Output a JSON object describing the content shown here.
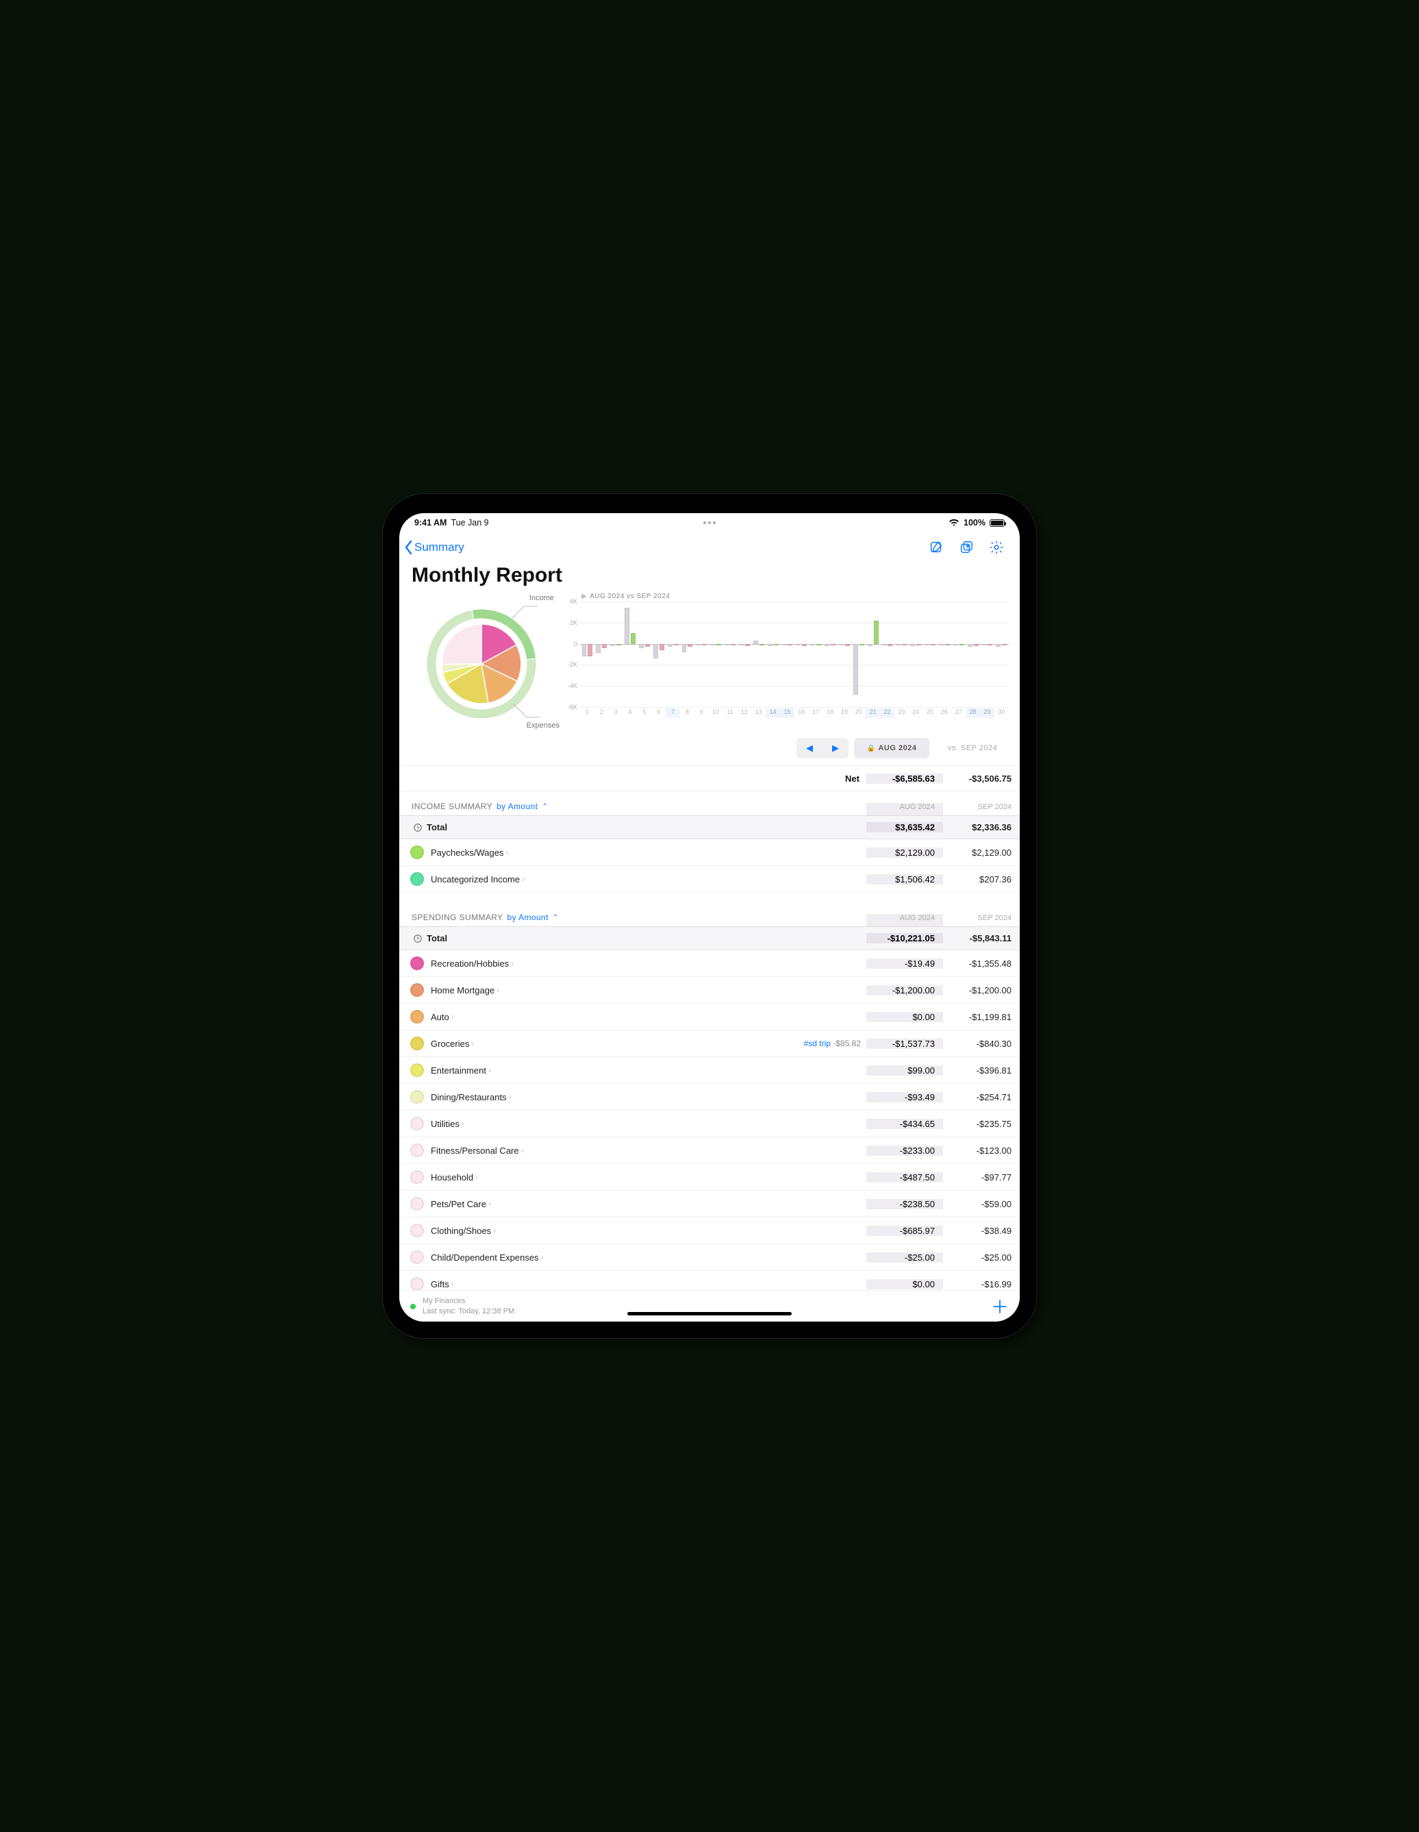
{
  "status": {
    "time": "9:41 AM",
    "date": "Tue Jan 9",
    "battery": "100%"
  },
  "nav": {
    "back": "Summary"
  },
  "title": "Monthly Report",
  "donut": {
    "income_label": "Income",
    "expenses_label": "Expenses"
  },
  "bar_legend": "AUG 2024 vs SEP 2024",
  "period": {
    "aug": "AUG 2024",
    "sep_vs": "vs. SEP 2024"
  },
  "net": {
    "label": "Net",
    "aug": "-$6,585.63",
    "sep": "-$3,506.75"
  },
  "income": {
    "header": "INCOME SUMMARY",
    "sort": "by Amount",
    "col_aug": "AUG 2024",
    "col_sep": "SEP 2024",
    "total_label": "Total",
    "total_aug": "$3,635.42",
    "total_sep": "$2,336.36",
    "rows": [
      {
        "name": "Paychecks/Wages",
        "aug": "$2,129.00",
        "sep": "$2,129.00",
        "color": "#a3e160"
      },
      {
        "name": "Uncategorized Income",
        "aug": "$1,506.42",
        "sep": "$207.36",
        "color": "#5be0a4"
      }
    ]
  },
  "spending": {
    "header": "SPENDING SUMMARY",
    "sort": "by Amount",
    "col_aug": "AUG 2024",
    "col_sep": "SEP 2024",
    "total_label": "Total",
    "total_aug": "-$10,221.05",
    "total_sep": "-$5,843.11",
    "rows": [
      {
        "name": "Recreation/Hobbies",
        "aug": "-$19.49",
        "sep": "-$1,355.48",
        "color": "#e75ca6"
      },
      {
        "name": "Home Mortgage",
        "aug": "-$1,200.00",
        "sep": "-$1,200.00",
        "color": "#ea9a6e"
      },
      {
        "name": "Auto",
        "aug": "$0.00",
        "sep": "-$1,199.81",
        "color": "#efb069"
      },
      {
        "name": "Groceries",
        "aug": "-$1,537.73",
        "sep": "-$840.30",
        "color": "#e7d55a",
        "note_tag": "#sd trip",
        "note_amt": "-$85.82"
      },
      {
        "name": "Entertainment",
        "aug": "$99.00",
        "sep": "-$396.81",
        "color": "#e9e96b"
      },
      {
        "name": "Dining/Restaurants",
        "aug": "-$93.49",
        "sep": "-$254.71",
        "color": "#eef2c0"
      },
      {
        "name": "Utilities",
        "aug": "-$434.65",
        "sep": "-$235.75",
        "color": "#fbe8ef"
      },
      {
        "name": "Fitness/Personal Care",
        "aug": "-$233.00",
        "sep": "-$123.00",
        "color": "#fbe8ef"
      },
      {
        "name": "Household",
        "aug": "-$487.50",
        "sep": "-$97.77",
        "color": "#fbe8ef"
      },
      {
        "name": "Pets/Pet Care",
        "aug": "-$238.50",
        "sep": "-$59.00",
        "color": "#fbe8ef"
      },
      {
        "name": "Clothing/Shoes",
        "aug": "-$685.97",
        "sep": "-$38.49",
        "color": "#fbe8ef"
      },
      {
        "name": "Child/Dependent Expenses",
        "aug": "-$25.00",
        "sep": "-$25.00",
        "color": "#fbe8ef"
      },
      {
        "name": "Gifts",
        "aug": "$0.00",
        "sep": "-$16.99",
        "color": "#fbe8ef"
      }
    ]
  },
  "footer": {
    "account": "My Finances",
    "sync": "Last sync: Today, 12:38 PM"
  },
  "chart_data": {
    "donut": {
      "type": "pie",
      "title": "",
      "outer_ring": [
        {
          "name": "Income",
          "value": 3635.42,
          "color": "#9fd98f"
        },
        {
          "name": "Expenses",
          "value": 10221.05,
          "color": "#cfe8c2"
        }
      ],
      "inner_pie_expense_breakdown": [
        {
          "name": "Recreation/Hobbies",
          "value": 1355,
          "color": "#e75ca6"
        },
        {
          "name": "Home Mortgage",
          "value": 1200,
          "color": "#ea9a6e"
        },
        {
          "name": "Auto",
          "value": 1200,
          "color": "#efb069"
        },
        {
          "name": "Groceries",
          "value": 1538,
          "color": "#e7d55a"
        },
        {
          "name": "Entertainment",
          "value": 397,
          "color": "#e9e96b"
        },
        {
          "name": "Dining/Restaurants",
          "value": 255,
          "color": "#eef2c0"
        },
        {
          "name": "Other",
          "value": 2000,
          "color": "#fbe8ef"
        }
      ]
    },
    "bars": {
      "type": "bar",
      "title": "AUG 2024 vs SEP 2024",
      "xlabel": "",
      "ylabel": "",
      "ylim": [
        -6000,
        4000
      ],
      "yticks": [
        4000,
        2000,
        0,
        -2000,
        -4000,
        -6000
      ],
      "ytick_labels": [
        "4K",
        "2K",
        "0",
        "-2K",
        "-4K",
        "-6K"
      ],
      "x": [
        1,
        2,
        3,
        4,
        5,
        6,
        7,
        8,
        9,
        10,
        11,
        12,
        13,
        14,
        15,
        16,
        17,
        18,
        19,
        20,
        21,
        22,
        23,
        24,
        25,
        26,
        27,
        28,
        29,
        30
      ],
      "highlight_x": [
        7,
        14,
        15,
        21,
        22,
        28,
        29
      ],
      "series": [
        {
          "name": "AUG 2024",
          "color_pos": "#d9d3de",
          "color_neg": "#d9d3de",
          "values": [
            -1200,
            -900,
            -200,
            3400,
            -400,
            -1400,
            -300,
            -800,
            0,
            -100,
            -100,
            0,
            300,
            -200,
            0,
            0,
            -100,
            -200,
            0,
            -4800,
            -200,
            0,
            -150,
            -200,
            -120,
            -150,
            0,
            -300,
            0,
            -300
          ]
        },
        {
          "name": "SEP 2024",
          "color_pos": "#9fd675",
          "color_neg": "#e6a9b0",
          "values": [
            -1200,
            -400,
            0,
            1000,
            -300,
            -600,
            -100,
            -300,
            -100,
            0,
            -100,
            -200,
            0,
            0,
            -100,
            -200,
            0,
            -100,
            -200,
            0,
            2200,
            -200,
            -100,
            -150,
            -120,
            -100,
            0,
            -200,
            -80,
            -150
          ]
        }
      ]
    }
  }
}
